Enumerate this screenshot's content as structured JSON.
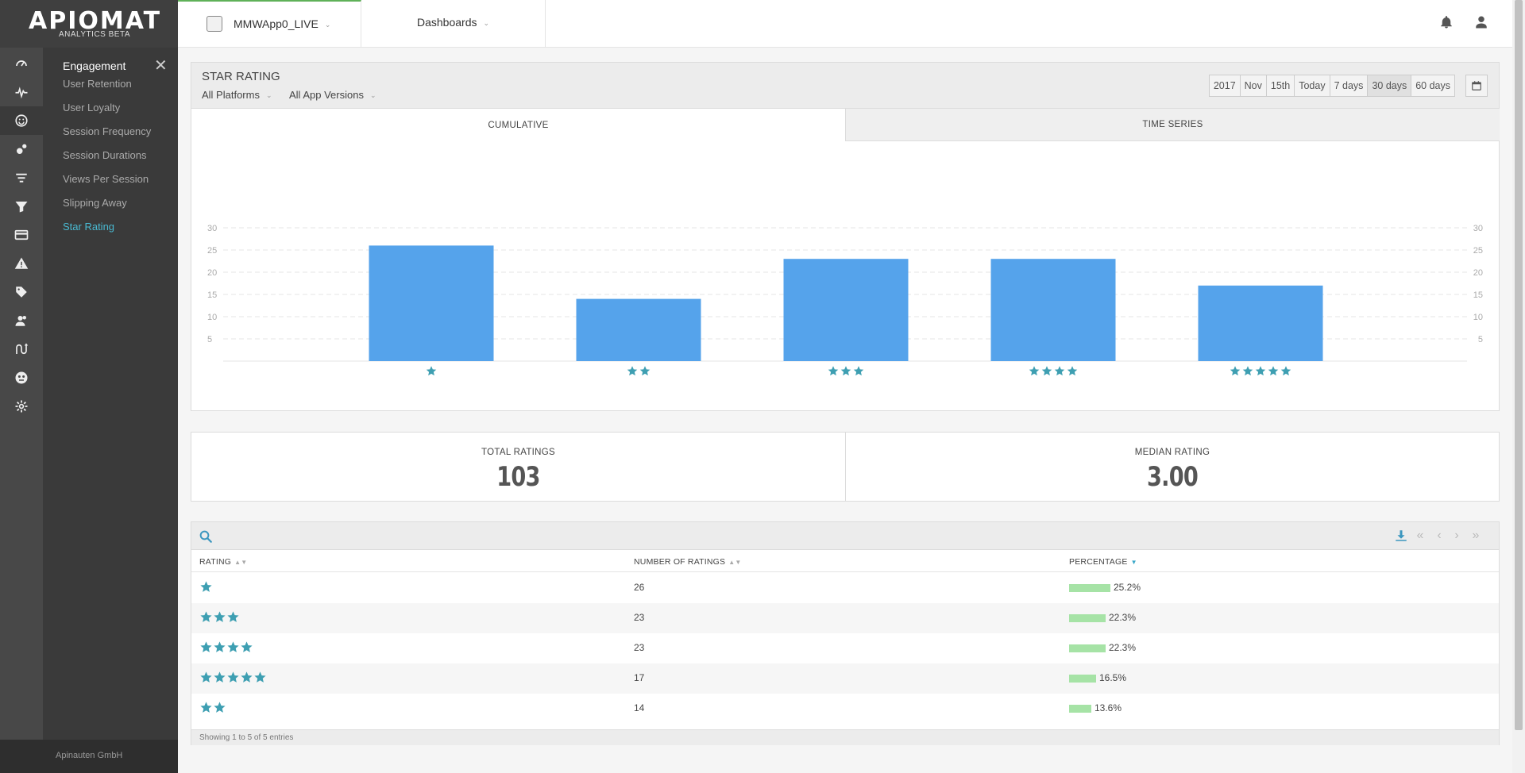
{
  "brand": {
    "logo": "APIOMAT",
    "subtitle": "ANALYTICS BETA"
  },
  "rail_icons": [
    "dashboard-icon",
    "heartbeat-icon",
    "smiley-icon",
    "events-icon",
    "filter-icon",
    "funnel-icon",
    "card-icon",
    "warning-icon",
    "tag-icon",
    "users-icon",
    "flows-icon",
    "crashes-icon",
    "gear-icon"
  ],
  "submenu": {
    "title": "Engagement",
    "close": "✕",
    "items": [
      "User Retention",
      "User Loyalty",
      "Session Frequency",
      "Session Durations",
      "Views Per Session",
      "Slipping Away",
      "Star Rating"
    ],
    "active_index": 6
  },
  "footer": {
    "company": "Apinauten GmbH"
  },
  "topbar": {
    "app_name": "MMWApp0_LIVE",
    "dashboards": "Dashboards"
  },
  "panel": {
    "title": "STAR RATING",
    "platform_filter": "All Platforms",
    "version_filter": "All App Versions",
    "ranges": [
      "2017",
      "Nov",
      "15th",
      "Today",
      "7 days",
      "30 days",
      "60 days"
    ],
    "active_range": "30 days",
    "tabs": [
      "CUMULATIVE",
      "TIME SERIES"
    ]
  },
  "chart_data": {
    "type": "bar",
    "categories": [
      "1 star",
      "2 stars",
      "3 stars",
      "4 stars",
      "5 stars"
    ],
    "star_counts": [
      1,
      2,
      3,
      4,
      5
    ],
    "values": [
      26,
      14,
      23,
      23,
      17
    ],
    "yticks": [
      5,
      10,
      15,
      20,
      25,
      30
    ],
    "ylim": [
      0,
      30
    ],
    "grid": true,
    "bar_color": "#55a3eb",
    "title": "",
    "xlabel": "",
    "ylabel": ""
  },
  "stats": {
    "total_label": "TOTAL RATINGS",
    "total_value": "103",
    "median_label": "MEDIAN RATING",
    "median_value": "3.00"
  },
  "table": {
    "headers": [
      "RATING",
      "NUMBER OF RATINGS",
      "PERCENTAGE"
    ],
    "rows": [
      {
        "stars": 1,
        "count": "26",
        "pct": "25.2%",
        "pct_value": 25.2
      },
      {
        "stars": 3,
        "count": "23",
        "pct": "22.3%",
        "pct_value": 22.3
      },
      {
        "stars": 4,
        "count": "23",
        "pct": "22.3%",
        "pct_value": 22.3
      },
      {
        "stars": 5,
        "count": "17",
        "pct": "16.5%",
        "pct_value": 16.5
      },
      {
        "stars": 2,
        "count": "14",
        "pct": "13.6%",
        "pct_value": 13.6
      }
    ],
    "info": "Showing 1 to 5 of 5 entries"
  },
  "colors": {
    "accent": "#49b9d1",
    "star": "#3e9fb2",
    "bar": "#55a3eb",
    "pct_bar": "#a6e3a6"
  }
}
